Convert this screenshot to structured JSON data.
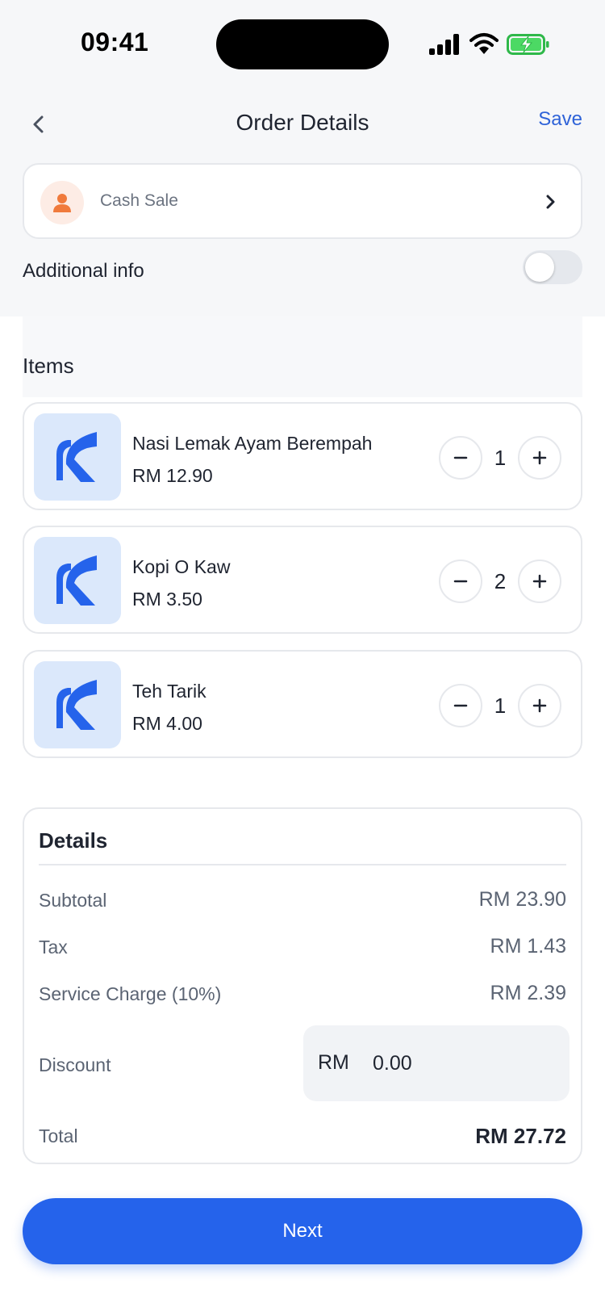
{
  "status_bar": {
    "time": "09:41"
  },
  "header": {
    "title": "Order Details",
    "save_label": "Save"
  },
  "customer": {
    "label": "Cash Sale"
  },
  "additional_info": {
    "label": "Additional info",
    "enabled": false
  },
  "items_section": {
    "title": "Items"
  },
  "items": [
    {
      "name": "Nasi Lemak Ayam Berempah",
      "price": "RM 12.90",
      "qty": "1"
    },
    {
      "name": "Kopi O Kaw",
      "price": "RM 3.50",
      "qty": "2"
    },
    {
      "name": "Teh Tarik",
      "price": "RM 4.00",
      "qty": "1"
    }
  ],
  "details": {
    "title": "Details",
    "subtotal_label": "Subtotal",
    "subtotal_value": "RM 23.90",
    "tax_label": "Tax",
    "tax_value": "RM 1.43",
    "service_label": "Service Charge (10%)",
    "service_value": "RM 2.39",
    "discount_label": "Discount",
    "discount_currency": "RM",
    "discount_value": "0.00",
    "total_label": "Total",
    "total_value": "RM 27.72"
  },
  "next_label": "Next",
  "colors": {
    "accent": "#2563eb",
    "link": "#2f63d8",
    "avatar_bg": "#fdece5",
    "avatar_icon": "#f07a3c",
    "thumb_bg": "#dbe8fb"
  },
  "icons": {
    "back": "chevron-left-icon",
    "customer": "user-icon",
    "chevron": "chevron-right-icon",
    "thumb": "brand-logo-icon",
    "minus": "minus-icon",
    "plus": "plus-icon"
  }
}
